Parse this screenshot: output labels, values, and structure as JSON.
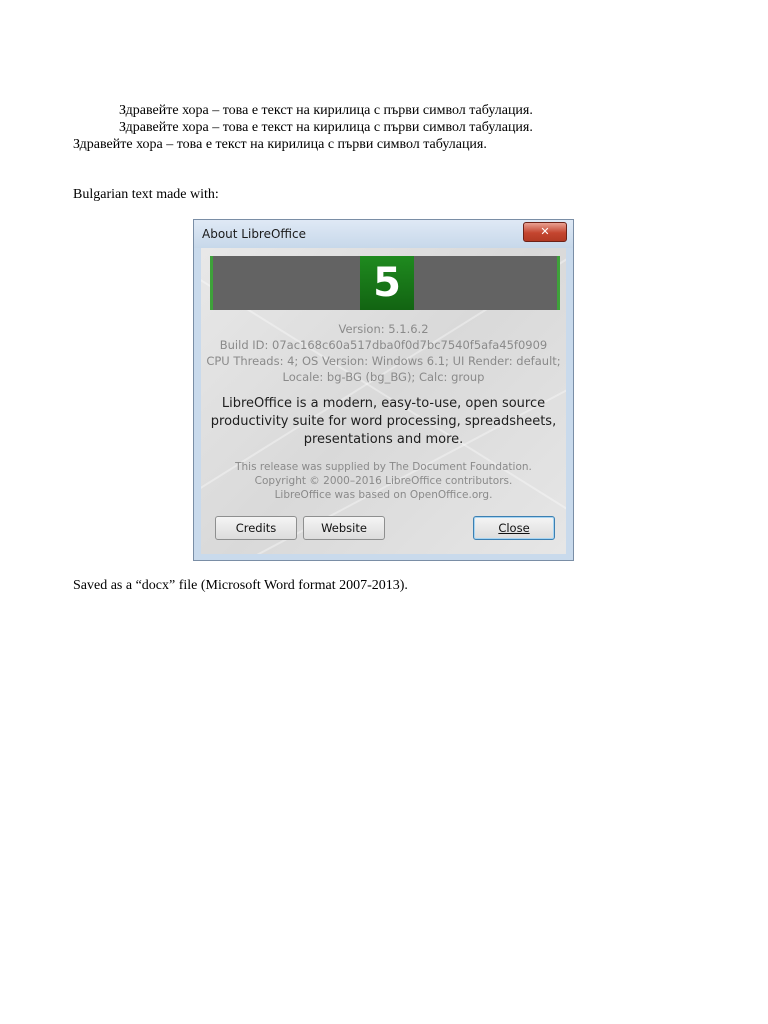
{
  "document": {
    "lines": [
      "Здравейте хора – това е текст на кирилица с първи символ табулация.",
      "Здравейте хора – това е текст на кирилица с първи символ табулация.",
      "Здравейте хора – това е текст на кирилица с първи символ табулация."
    ],
    "made_with": "Bulgarian text made with:",
    "saved_as": "Saved as a “docx” file (Microsoft Word format 2007-2013)."
  },
  "dialog": {
    "title": "About LibreOffice",
    "close_glyph": "✕",
    "badge": "5",
    "version": "Version: 5.1.6.2",
    "build_id": "Build ID: 07ac168c60a517dba0f0d7bc7540f5afa45f0909",
    "cpu": "CPU Threads: 4; OS Version: Windows 6.1; UI Render: default;",
    "locale": "Locale: bg-BG (bg_BG); Calc: group",
    "desc": [
      "LibreOffice is a modern, easy-to-use, open source",
      "productivity suite for word processing, spreadsheets,",
      "presentations and more."
    ],
    "notes": [
      "This release was supplied by The Document Foundation.",
      "Copyright © 2000–2016 LibreOffice contributors.",
      "LibreOffice was based on OpenOffice.org."
    ],
    "buttons": {
      "credits": "Credits",
      "website": "Website",
      "close": "Close"
    }
  },
  "colors": {
    "accent_green": "#3ea23a",
    "badge_green": "#1f8a1f",
    "banner_gray": "#636363"
  }
}
